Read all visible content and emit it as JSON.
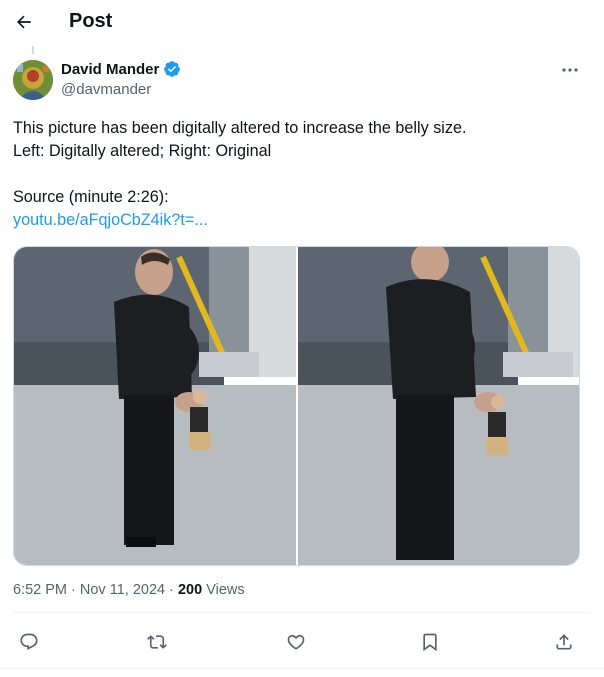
{
  "header": {
    "title": "Post"
  },
  "author": {
    "display_name": "David Mander",
    "handle": "@davmander",
    "verified": true
  },
  "tweet": {
    "line1": "This picture has been digitally altered to increase the belly size.",
    "line2": "Left: Digitally altered; Right: Original",
    "source_label": "Source (minute 2:26):",
    "link_text": "youtu.be/aFqjoCbZ4ik?t=..."
  },
  "meta": {
    "time": "6:52 PM",
    "sep1": " · ",
    "date": "Nov 11, 2024",
    "sep2": " · ",
    "views_count": "200",
    "views_label": " Views"
  },
  "actions": [
    "reply-icon",
    "repost-icon",
    "like-icon",
    "bookmark-icon",
    "share-icon"
  ],
  "colors": {
    "accent": "#1d9bf0",
    "text": "#0f1419",
    "secondary": "#536471"
  }
}
